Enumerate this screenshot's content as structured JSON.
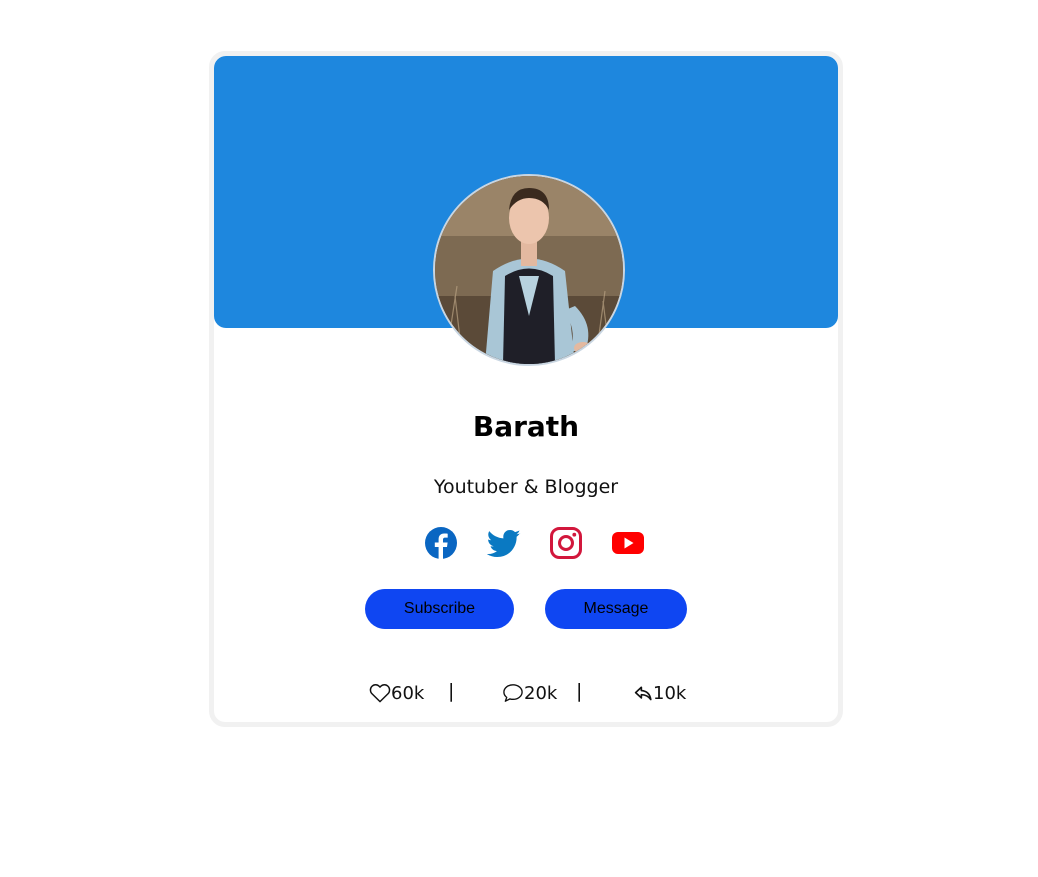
{
  "profile": {
    "name": "Barath",
    "tagline": "Youtuber & Blogger"
  },
  "social": [
    {
      "icon": "facebook-icon",
      "color": "#0a66c2"
    },
    {
      "icon": "twitter-icon",
      "color": "#0a79c2"
    },
    {
      "icon": "instagram-icon",
      "color": "#d2173c"
    },
    {
      "icon": "youtube-icon",
      "color": "#ff0000"
    }
  ],
  "actions": {
    "subscribe_label": "Subscribe",
    "message_label": "Message"
  },
  "stats": {
    "likes": "60k",
    "comments": "20k",
    "shares": "10k",
    "separator": "|"
  },
  "colors": {
    "banner": "#1e87de",
    "button": "#0f46f2"
  }
}
